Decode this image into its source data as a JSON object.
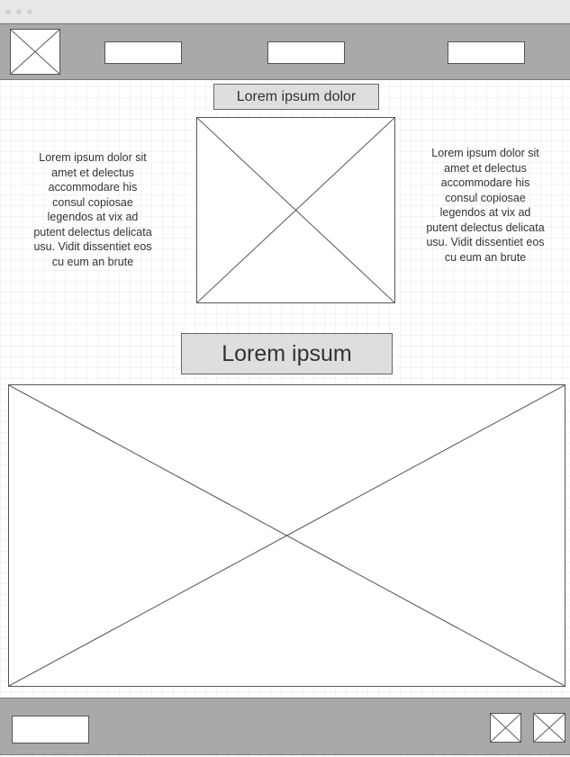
{
  "header": {
    "nav_items": [
      "",
      "",
      ""
    ]
  },
  "main": {
    "caption_small": "Lorem ipsum dolor",
    "paragraph_left": "Lorem ipsum dolor sit amet et delectus accommodare his consul copiosae legendos at vix ad putent delectus delicata usu. Vidit dissentiet eos cu eum an brute",
    "paragraph_right": "Lorem ipsum dolor sit amet et delectus accommodare his consul copiosae legendos at vix ad putent delectus delicata usu. Vidit dissentiet eos cu eum an brute",
    "caption_large": "Lorem ipsum"
  },
  "footer": {
    "left_box": ""
  },
  "icons": {
    "placeholder": "image-placeholder-icon"
  },
  "colors": {
    "bar": "#a9a9a9",
    "label_bg": "#dedede",
    "titlebar": "#e8e8e8"
  }
}
